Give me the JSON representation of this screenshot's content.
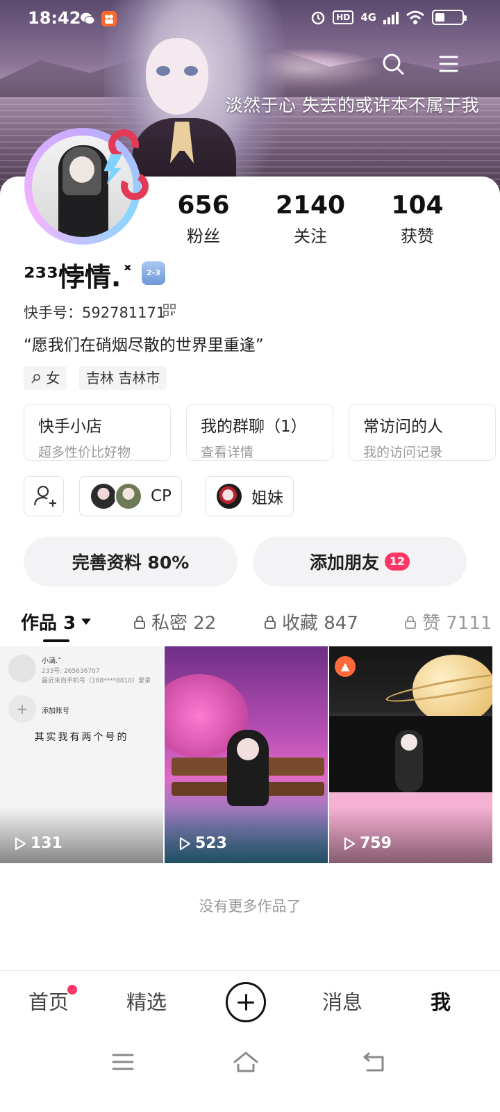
{
  "status_bar": {
    "time": "18:42",
    "icons": [
      "wechat-icon",
      "kuaishou-icon",
      "alarm-icon",
      "hd-icon",
      "4g-signal-icon",
      "wifi-icon",
      "battery-icon"
    ],
    "hd_label": "HD",
    "network_label": "4G",
    "battery_level": 0.35
  },
  "banner": {
    "quote": "淡然于心 失去的或许本不属于我",
    "icons": [
      "search-icon",
      "menu-icon"
    ]
  },
  "profile": {
    "username": "²³³悖情.˟",
    "kwai_id_label": "快手号：",
    "kwai_id": "592781171",
    "bio": "“愿我们在硝烟尽散的世界里重逢”",
    "gender": "女",
    "location": "吉林 吉林市",
    "badge_text": "2-3",
    "stats": [
      {
        "value": "656",
        "label": "粉丝"
      },
      {
        "value": "2140",
        "label": "关注"
      },
      {
        "value": "104",
        "label": "获赞"
      }
    ]
  },
  "entries": [
    {
      "title": "快手小店",
      "subtitle": "超多性价比好物"
    },
    {
      "title": "我的群聊（1）",
      "subtitle": "查看详情"
    },
    {
      "title": "常访问的人",
      "subtitle": "我的访问记录"
    }
  ],
  "relations": [
    {
      "label": "CP"
    },
    {
      "label": "姐妹"
    }
  ],
  "actions": {
    "complete_profile": "完善资料 80%",
    "add_friends": "添加朋友",
    "add_friends_badge": "12"
  },
  "tabs": [
    {
      "label": "作品 3",
      "active": true
    },
    {
      "label": "私密 22",
      "locked": true
    },
    {
      "label": "收藏 847",
      "locked": true
    },
    {
      "label": "赞 7111",
      "locked": true
    }
  ],
  "works": [
    {
      "plays": "131",
      "overlay": {
        "name": "小涵.˟",
        "id": "233号: 265636707",
        "login": "最近来自手机号（188****8810）登录",
        "add_account": "添加账号",
        "caption": "其实我有两个号的"
      }
    },
    {
      "plays": "523"
    },
    {
      "plays": "759"
    }
  ],
  "no_more": "没有更多作品了",
  "bottom_nav": {
    "home": "首页",
    "featured": "精选",
    "messages": "消息",
    "me": "我"
  },
  "colors": {
    "accent_red": "#fe3666",
    "text_primary": "#111111",
    "text_secondary": "#999999",
    "chip_bg": "#f3f3f5"
  }
}
